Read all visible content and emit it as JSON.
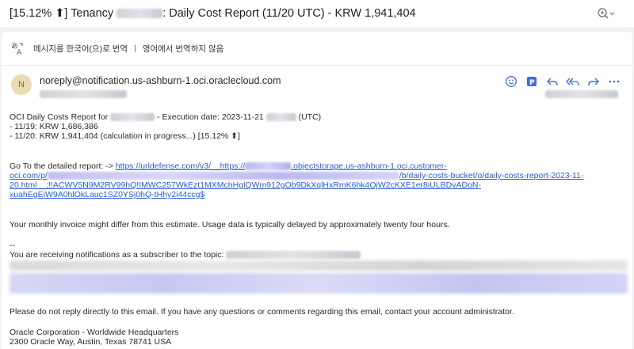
{
  "subject": {
    "prefix": "[15.12% ⬆] Tenancy ",
    "suffix": ": Daily Cost Report (11/20 UTC) - KRW 1,941,404"
  },
  "translate_bar": {
    "translate_label": "메시지를 한국어(으)로 번역",
    "separator": "|",
    "never_translate_label": "영어에서 번역하지 않음"
  },
  "sender": {
    "avatar_letter": "N",
    "email": "noreply@notification.us-ashburn-1.oci.oraclecloud.com"
  },
  "body": {
    "line1_prefix": "OCI Daily Costs Report for ",
    "line1_middle": " - Execution date: 2023-11-21 ",
    "line1_suffix": " (UTC)",
    "line2": "- 11/19: KRW 1,686,386",
    "line3": "- 11/20: KRW 1,941,404 (calculation in progress...) [15.12% ⬆]",
    "goto_prefix": "Go To the detailed report:  -> ",
    "link_part1": "https://urldefense.com/v3/__https://",
    "link_part2": ".objectstorage.us-ashburn-1.oci.customer-",
    "link_line2_prefix": "oci.com/p/",
    "link_line2_suffix": "/b/daily-costs-bucket/o/daily-costs-report-2023-11-",
    "link_line3": "20.html__;!!ACWV5N9M2RV99hQ!IMWC257WkEzt1MXMchHglQWm912gOb9DkXqlHxRmK6hk4OjW2cKXE1er8iULBDvADoN-",
    "link_line4": "xuahEgEiW9A0hlOkLauc1SZ0YSj0hQ-tHhy2i44ccg$",
    "invoice_note": "Your monthly invoice might differ from this estimate. Usage data is typically delayed by approximately twenty four hours.",
    "sig_dashes": "--",
    "subscriber_line": "You are receiving notifications as a subscriber to the topic: ",
    "no_reply": "Please do not reply directly to this email. If you have any questions or comments regarding this email, contact your account administrator.",
    "company": "Oracle Corporation - Worldwide Headquarters",
    "address": "2300 Oracle Way, Austin, Texas 78741 USA"
  },
  "icons": {
    "zoom": "zoom-in-icon",
    "translate": "translate-icon",
    "emoji": "emoji-reaction-icon",
    "app": "app-badge-icon",
    "reply": "reply-icon",
    "reply_all": "reply-all-icon",
    "forward": "forward-icon",
    "more": "more-options-icon"
  },
  "colors": {
    "link": "#2a5bd7",
    "action_icon": "#3b6fd8",
    "avatar_bg": "#e8dcb4"
  }
}
